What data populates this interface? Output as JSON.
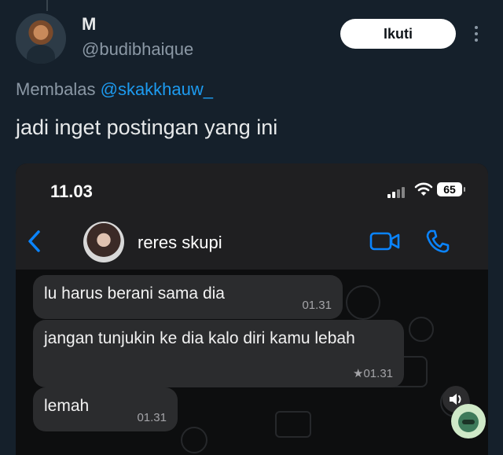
{
  "tweet": {
    "display_name": "M",
    "handle": "@budibhaique",
    "follow_label": "Ikuti",
    "reply_prefix": "Membalas",
    "reply_to": "@skakkhauw_",
    "text": "jadi inget postingan yang ini"
  },
  "embedded_chat": {
    "status_bar": {
      "time": "11.03",
      "battery": "65"
    },
    "contact_name": "reres skupi",
    "messages": [
      {
        "text": "lu harus berani sama dia",
        "time": "01.31"
      },
      {
        "text": "jangan tunjukin ke dia kalo diri kamu lebah",
        "time": "★01.31"
      },
      {
        "text": "lemah",
        "time": "01.31"
      }
    ]
  },
  "icons": {
    "more": "more-vertical-icon",
    "back": "chevron-left-icon",
    "video": "video-call-icon",
    "phone": "phone-icon",
    "wifi": "wifi-icon",
    "signal": "signal-icon",
    "battery": "battery-icon",
    "speaker": "speaker-icon",
    "sticker": "sticker-icon"
  },
  "colors": {
    "background": "#15202b",
    "accent": "#1d9bf0",
    "ios_blue": "#0a84ff",
    "bubble": "#2b2c2e"
  }
}
